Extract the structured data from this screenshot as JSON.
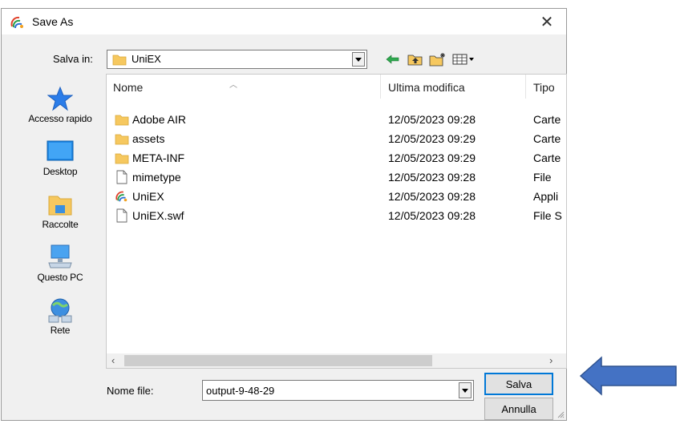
{
  "window": {
    "title": "Save As",
    "close_glyph": "✕"
  },
  "save_in": {
    "label": "Salva in:",
    "value": "UniEX"
  },
  "toolbar": {
    "icons": [
      "back-arrow-icon",
      "up-folder-icon",
      "new-folder-icon",
      "view-menu-icon"
    ]
  },
  "places": [
    {
      "label": "Accesso rapido",
      "icon": "star-icon"
    },
    {
      "label": "Desktop",
      "icon": "desktop-icon"
    },
    {
      "label": "Raccolte",
      "icon": "libraries-icon"
    },
    {
      "label": "Questo PC",
      "icon": "computer-icon"
    },
    {
      "label": "Rete",
      "icon": "network-icon"
    }
  ],
  "columns": {
    "name": "Nome",
    "modified": "Ultima modifica",
    "type": "Tipo"
  },
  "files": [
    {
      "name": "Adobe AIR",
      "modified": "12/05/2023 09:28",
      "type": "Carte",
      "icon": "folder"
    },
    {
      "name": "assets",
      "modified": "12/05/2023 09:29",
      "type": "Carte",
      "icon": "folder"
    },
    {
      "name": "META-INF",
      "modified": "12/05/2023 09:29",
      "type": "Carte",
      "icon": "folder"
    },
    {
      "name": "mimetype",
      "modified": "12/05/2023 09:28",
      "type": "File",
      "icon": "file"
    },
    {
      "name": "UniEX",
      "modified": "12/05/2023 09:28",
      "type": "Appli",
      "icon": "app"
    },
    {
      "name": "UniEX.swf",
      "modified": "12/05/2023 09:28",
      "type": "File S",
      "icon": "file"
    }
  ],
  "filename": {
    "label": "Nome file:",
    "value": "output-9-48-29"
  },
  "buttons": {
    "save": "Salva",
    "cancel": "Annulla"
  },
  "colors": {
    "annotation_arrow": "#4472c4",
    "folder": "#f6c85f",
    "primary_border": "#0078d7"
  }
}
